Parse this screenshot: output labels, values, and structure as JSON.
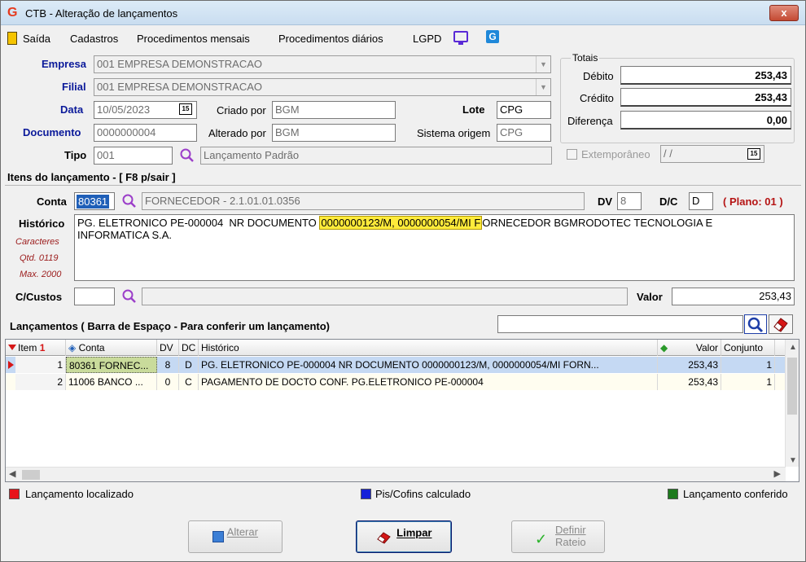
{
  "window": {
    "title": "CTB - Alteração de lançamentos",
    "close": "x"
  },
  "menu": [
    "Saída",
    "Cadastros",
    "Procedimentos mensais",
    "Procedimentos diários",
    "LGPD"
  ],
  "header": {
    "empresa_label": "Empresa",
    "empresa_value": "001 EMPRESA DEMONSTRACAO",
    "filial_label": "Filial",
    "filial_value": "001 EMPRESA DEMONSTRACAO",
    "data_label": "Data",
    "data_value": "10/05/2023",
    "criado_label": "Criado por",
    "criado_value": "BGM",
    "lote_label": "Lote",
    "lote_value": "CPG",
    "documento_label": "Documento",
    "documento_value": "0000000004",
    "alterado_label": "Alterado por",
    "alterado_value": "BGM",
    "sistema_label": "Sistema origem",
    "sistema_value": "CPG",
    "tipo_label": "Tipo",
    "tipo_value": "001",
    "tipo_desc": "Lançamento Padrão",
    "extemporaneo_label": "Extemporâneo",
    "extemporaneo_date": " / /"
  },
  "totais": {
    "title": "Totais",
    "debito_label": "Débito",
    "debito_value": "253,43",
    "credito_label": "Crédito",
    "credito_value": "253,43",
    "diferenca_label": "Diferença",
    "diferenca_value": "0,00"
  },
  "itens": {
    "title": "Itens do lançamento - [ F8 p/sair ]",
    "conta_label": "Conta",
    "conta_value": "80361",
    "conta_desc": "FORNECEDOR - 2.1.01.01.0356",
    "dv_label": "DV",
    "dv_value": "8",
    "dc_label": "D/C",
    "dc_value": "D",
    "plano": "( Plano: 01 )",
    "historico_label": "Histórico",
    "historico_pre": "PG. ELETRONICO PE-000004  NR DOCUMENTO ",
    "historico_hl": "0000000123/M, 0000000054/MI F",
    "historico_post": "ORNECEDOR BGMRODOTEC TECNOLOGIA E",
    "historico_line2": "INFORMATICA S.A.",
    "caracteres": "Caracteres",
    "qtd": "Qtd. 0119",
    "max": "Max. 2000",
    "ccustos_label": "C/Custos",
    "valor_label": "Valor",
    "valor_value": "253,43"
  },
  "lancamentos": {
    "title": "Lançamentos ( Barra de Espaço - Para conferir um lançamento)",
    "columns": [
      "Item",
      "Conta",
      "DV",
      "DC",
      "Histórico",
      "Valor",
      "Conjunto"
    ],
    "rows": [
      {
        "item": "1",
        "conta": "80361 FORNEC...",
        "dv": "8",
        "dc": "D",
        "historico": "PG. ELETRONICO PE-000004  NR DOCUMENTO  0000000123/M, 0000000054/MI FORN...",
        "valor": "253,43",
        "conjunto": "1"
      },
      {
        "item": "2",
        "conta": "11006 BANCO ...",
        "dv": "0",
        "dc": "C",
        "historico": "PAGAMENTO DE DOCTO CONF. PG.ELETRONICO PE-000004",
        "valor": "253,43",
        "conjunto": "1"
      }
    ]
  },
  "legend": {
    "localizado": "Lançamento localizado",
    "pis": "Pis/Cofins calculado",
    "conferido": "Lançamento conferido",
    "colors": {
      "red": "#e8131a",
      "blue": "#1521d8",
      "green": "#1d7a1d"
    }
  },
  "buttons": {
    "alterar": "Alterar",
    "limpar": "Limpar",
    "definir_1": "Definir",
    "definir_2": "Rateio"
  }
}
